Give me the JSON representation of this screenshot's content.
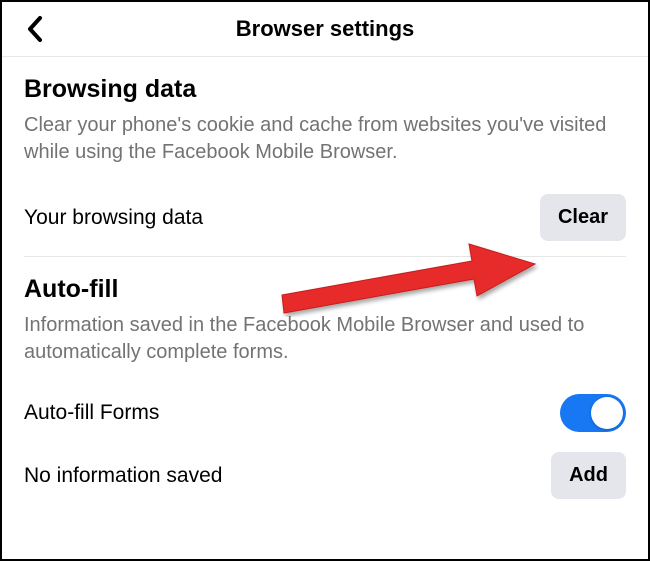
{
  "header": {
    "title": "Browser settings"
  },
  "browsingData": {
    "title": "Browsing data",
    "description": "Clear your phone's cookie and cache from websites you've visited while using the Facebook Mobile Browser.",
    "rowLabel": "Your browsing data",
    "clearButton": "Clear"
  },
  "autoFill": {
    "title": "Auto-fill",
    "description": "Information saved in the Facebook Mobile Browser and used to automatically complete forms.",
    "formsLabel": "Auto-fill Forms",
    "formsEnabled": true,
    "noInfoLabel": "No information saved",
    "addButton": "Add"
  }
}
